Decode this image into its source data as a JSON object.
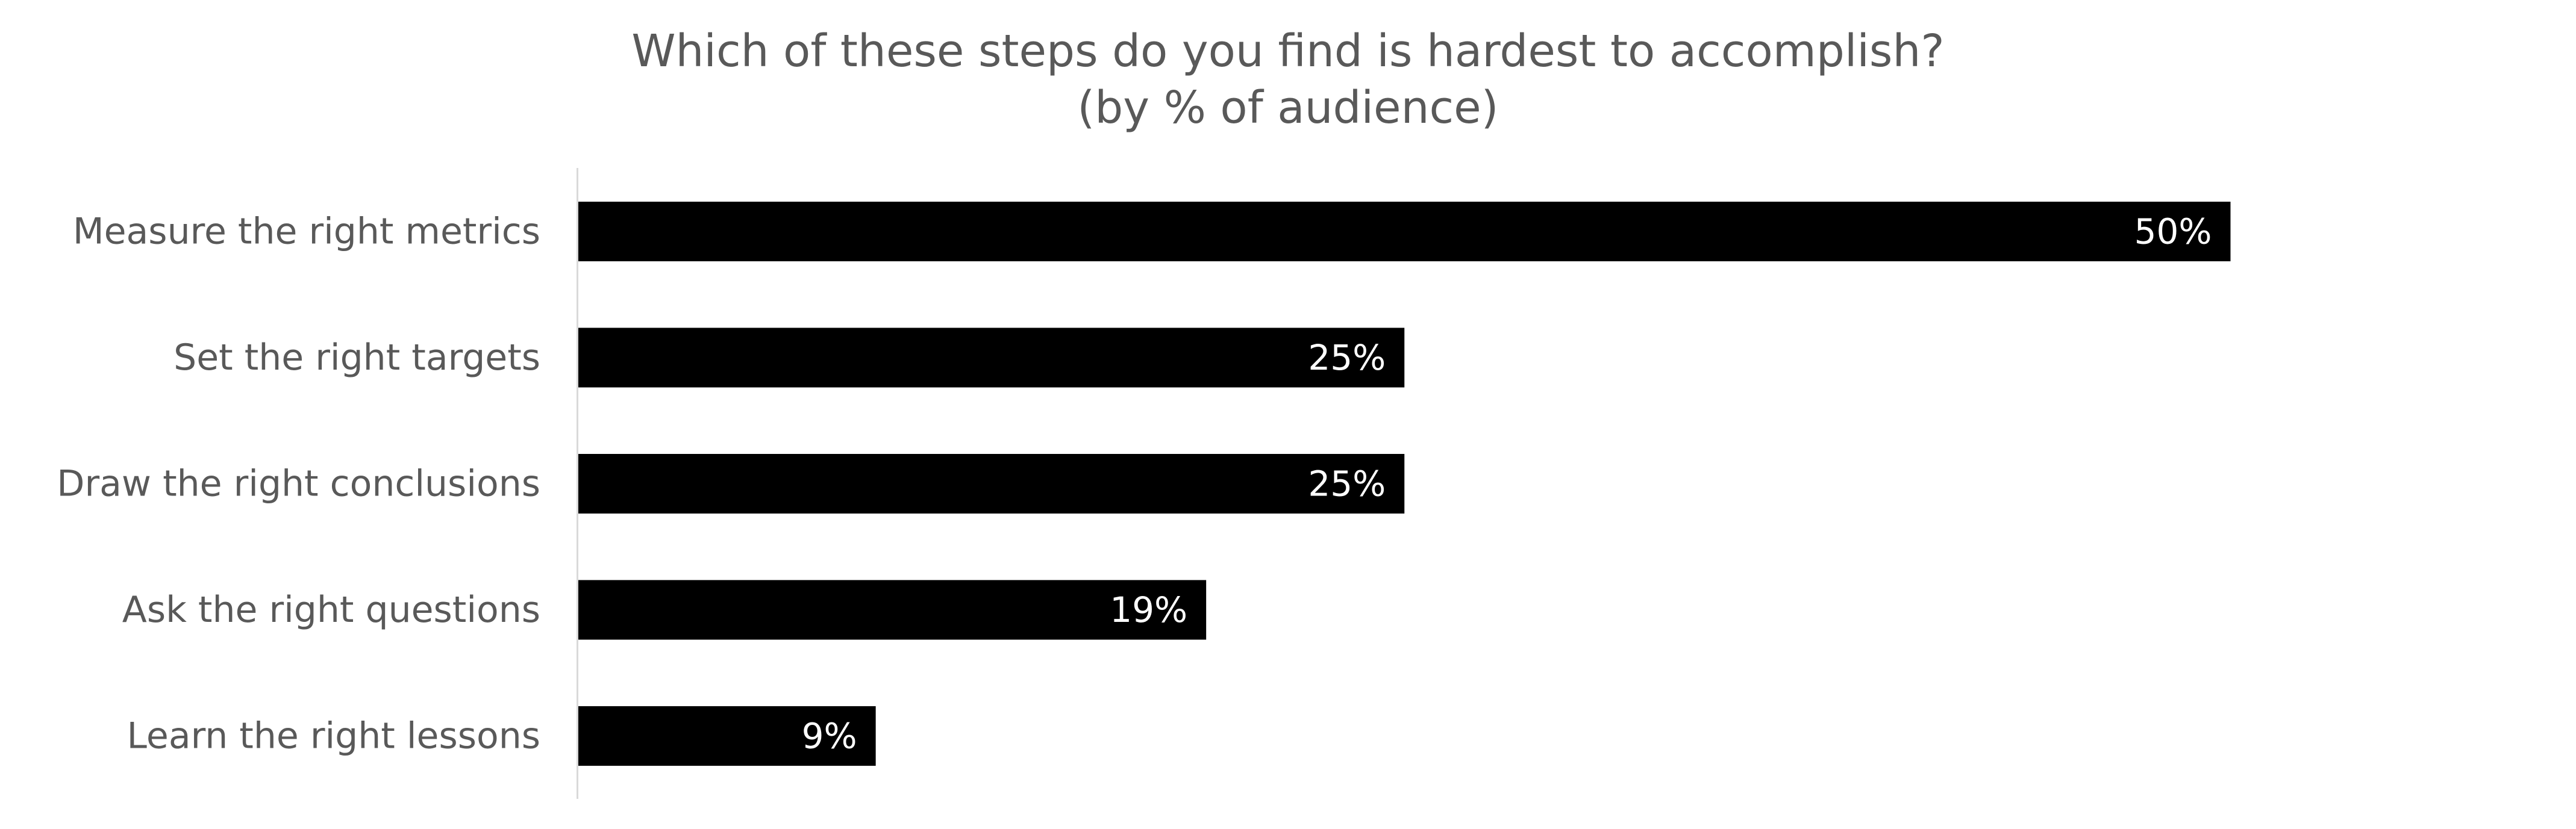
{
  "chart_data": {
    "type": "bar",
    "orientation": "horizontal",
    "title": "Which of these steps do you find is hardest to accomplish?",
    "subtitle": "(by % of audience)",
    "categories": [
      "Measure the right metrics",
      "Set the right targets",
      "Draw the right conclusions",
      "Ask the right questions",
      "Learn the right lessons"
    ],
    "values": [
      50,
      25,
      25,
      19,
      9
    ],
    "data_labels": [
      "50%",
      "25%",
      "25%",
      "19%",
      "9%"
    ],
    "unit": "%",
    "xlabel": "",
    "ylabel": "",
    "xlim": [
      0,
      70
    ],
    "grid": false,
    "legend": "none",
    "colors": {
      "bar": "#000000",
      "data_label": "#ffffff",
      "text": "#595959",
      "axis": "#d9d9d9",
      "background": "#ffffff"
    }
  }
}
